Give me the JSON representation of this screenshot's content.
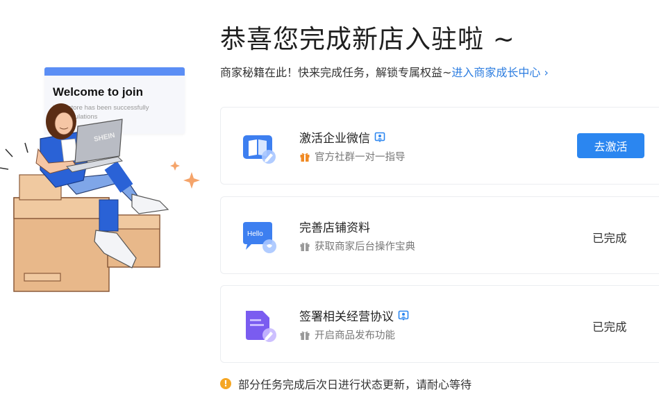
{
  "illustration": {
    "welcome_title": "Welcome to join",
    "welcome_sub": "Your store has been successfully congratulations"
  },
  "header": {
    "title": "恭喜您完成新店入驻啦 ~",
    "subtitle_prefix": "商家秘籍在此！快来完成任务，解锁专属权益~",
    "subtitle_link": "进入商家成长中心 ›"
  },
  "tasks": [
    {
      "name": "激活企业微信",
      "desc": "官方社群一对一指导",
      "action": "去激活",
      "icon": "book-pencil-icon"
    },
    {
      "name": "完善店铺资料",
      "desc": "获取商家后台操作宝典",
      "status": "已完成",
      "icon": "hello-chat-icon"
    },
    {
      "name": "签署相关经营协议",
      "desc": "开启商品发布功能",
      "status": "已完成",
      "icon": "document-sign-icon"
    }
  ],
  "notice": "部分任务完成后次日进行状态更新，请耐心等待",
  "colors": {
    "accent": "#2b86f0",
    "link": "#2b7ce0",
    "warning": "#f5a623",
    "gift": "#f08a24"
  }
}
